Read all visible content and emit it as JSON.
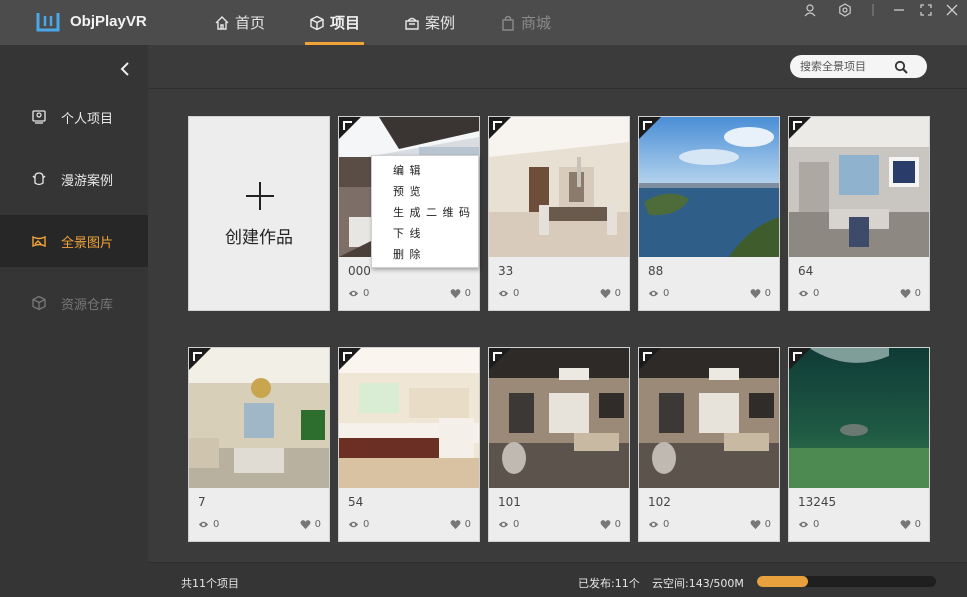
{
  "app": {
    "title": "ObjPlayVR"
  },
  "nav": {
    "tabs": [
      {
        "label": "首页",
        "icon": "home-icon"
      },
      {
        "label": "项目",
        "icon": "cube-icon",
        "active": true
      },
      {
        "label": "案例",
        "icon": "case-icon"
      },
      {
        "label": "商城",
        "icon": "shop-icon",
        "disabled": true
      }
    ]
  },
  "sidebar": {
    "items": [
      {
        "label": "个人项目",
        "icon": "personal-project-icon"
      },
      {
        "label": "漫游案例",
        "icon": "tour-case-icon"
      },
      {
        "label": "全景图片",
        "icon": "panorama-icon",
        "active": true
      },
      {
        "label": "资源仓库",
        "icon": "resource-icon",
        "disabled": true
      }
    ]
  },
  "search": {
    "placeholder": "搜索全景项目"
  },
  "create": {
    "label": "创建作品"
  },
  "projects": [
    {
      "title": "000",
      "views": "0",
      "likes": "0",
      "scene": "balcony"
    },
    {
      "title": "33",
      "views": "0",
      "likes": "0",
      "scene": "dining"
    },
    {
      "title": "88",
      "views": "0",
      "likes": "0",
      "scene": "lake"
    },
    {
      "title": "64",
      "views": "0",
      "likes": "0",
      "scene": "living"
    },
    {
      "title": "7",
      "views": "0",
      "likes": "0",
      "scene": "livingroom-tv"
    },
    {
      "title": "54",
      "views": "0",
      "likes": "0",
      "scene": "kitchen"
    },
    {
      "title": "101",
      "views": "0",
      "likes": "0",
      "scene": "lounge"
    },
    {
      "title": "102",
      "views": "0",
      "likes": "0",
      "scene": "lounge"
    },
    {
      "title": "13245",
      "views": "0",
      "likes": "0",
      "scene": "underwater"
    }
  ],
  "context_menu": {
    "items": [
      "编 辑",
      "预 览",
      "生 成 二 维 码",
      "下 线",
      "删 除"
    ]
  },
  "footer": {
    "count": "共11个项目",
    "published": "已发布:11个",
    "space": "云空间:143/500M",
    "space_used_fraction": 0.286
  },
  "colors": {
    "accent": "#f0a339",
    "logo": "#4aa8e8"
  }
}
